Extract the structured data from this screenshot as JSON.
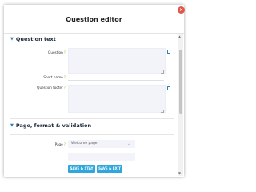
{
  "modal": {
    "title": "Question editor",
    "close_glyph": "×"
  },
  "sections": {
    "question_text": {
      "header": "Question text",
      "fields": {
        "question": {
          "label": "Question",
          "value": ""
        },
        "short_name": {
          "label": "Short name",
          "value": ""
        },
        "question_footer": {
          "label": "Question footer",
          "value": ""
        }
      }
    },
    "page_format": {
      "header": "Page, format & validation",
      "page": {
        "label": "Page",
        "selected": "Welcome page"
      }
    }
  },
  "help_glyph": "?",
  "chevron_glyph": "▼",
  "actions": {
    "save_and_stay": "SAVE & STAY",
    "save_and_exit": "SAVE & EXIT"
  },
  "colors": {
    "accent": "#2fa7dd",
    "close": "#e0554a",
    "help": "#8fc63f",
    "field_bg": "#f3f4fa"
  },
  "icons": [
    "close-icon",
    "chevron-down-icon",
    "help-icon",
    "document-icon",
    "resize-handle-icon"
  ]
}
